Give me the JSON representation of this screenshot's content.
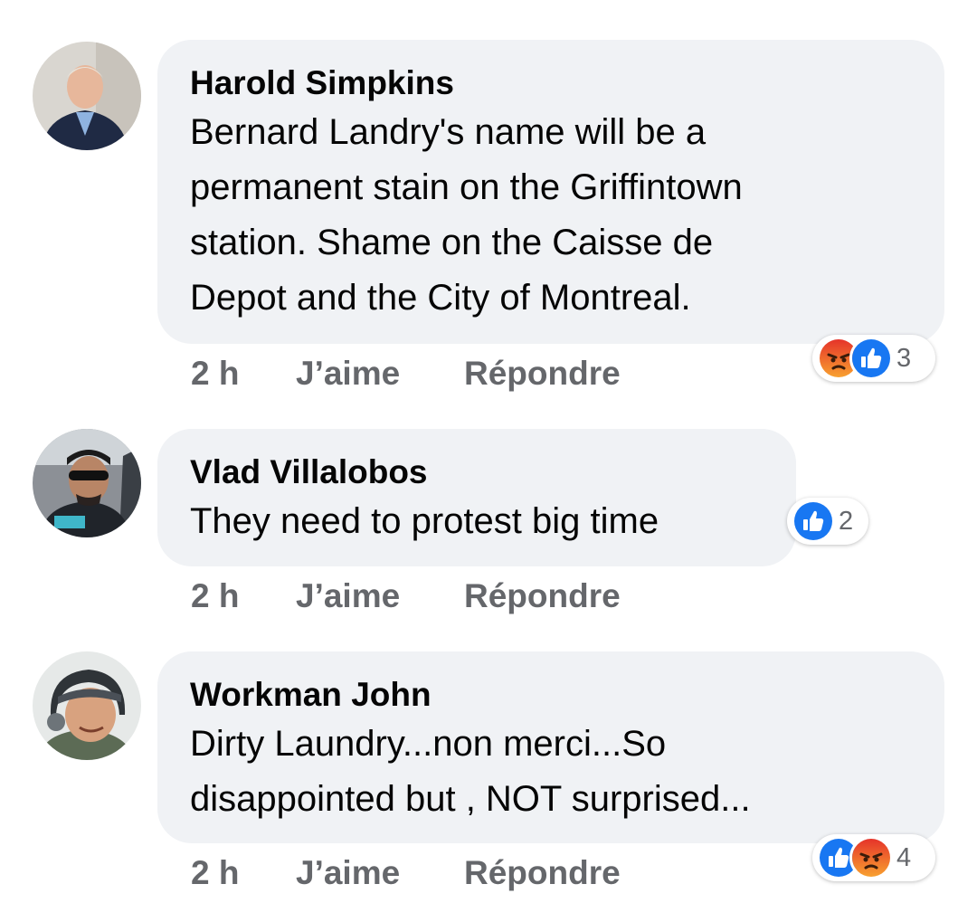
{
  "comments": [
    {
      "author": "Harold Simpkins",
      "lines": [
        "Bernard Landry's name will be a",
        "permanent stain on the Griffintown",
        "station. Shame on the Caisse de",
        "Depot and the City of Montreal."
      ],
      "time": "2 h",
      "like_label": "J’aime",
      "reply_label": "Répondre",
      "reactions": [
        "angry-icon",
        "like-icon"
      ],
      "reaction_count": "3"
    },
    {
      "author": "Vlad Villalobos",
      "lines": [
        "They need to protest big time"
      ],
      "time": "2 h",
      "like_label": "J’aime",
      "reply_label": "Répondre",
      "reactions": [
        "like-icon"
      ],
      "reaction_count": "2"
    },
    {
      "author": "Workman John",
      "lines": [
        "Dirty Laundry...non merci...So",
        "disappointed but , NOT surprised..."
      ],
      "time": "2 h",
      "like_label": "J’aime",
      "reply_label": "Répondre",
      "reactions": [
        "like-icon",
        "angry-icon"
      ],
      "reaction_count": "4"
    }
  ],
  "colors": {
    "bubble": "#f0f2f5",
    "meta_text": "#65676b",
    "like_blue": "#1877f2",
    "angry_orange": "#f06a25"
  }
}
